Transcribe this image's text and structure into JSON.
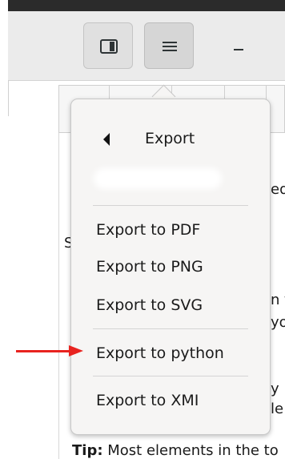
{
  "headerbar": {
    "buttons": [
      "sidebar-toggle",
      "main-menu",
      "minimize"
    ]
  },
  "background_fragments": {
    "f1": "ed",
    "f2": "S",
    "f3": "n t",
    "f4": "yo",
    "f5": "y",
    "f6": "le",
    "tip_label": "Tip:",
    "tip_text": " Most elements in the to"
  },
  "popover": {
    "back_label": "Export",
    "items": [
      {
        "label": "Export to PDF"
      },
      {
        "label": "Export to PNG"
      },
      {
        "label": "Export to SVG"
      },
      {
        "label": "Export to python"
      },
      {
        "label": "Export to XMI"
      }
    ]
  },
  "annotation": {
    "arrow_color": "#e8231f"
  }
}
